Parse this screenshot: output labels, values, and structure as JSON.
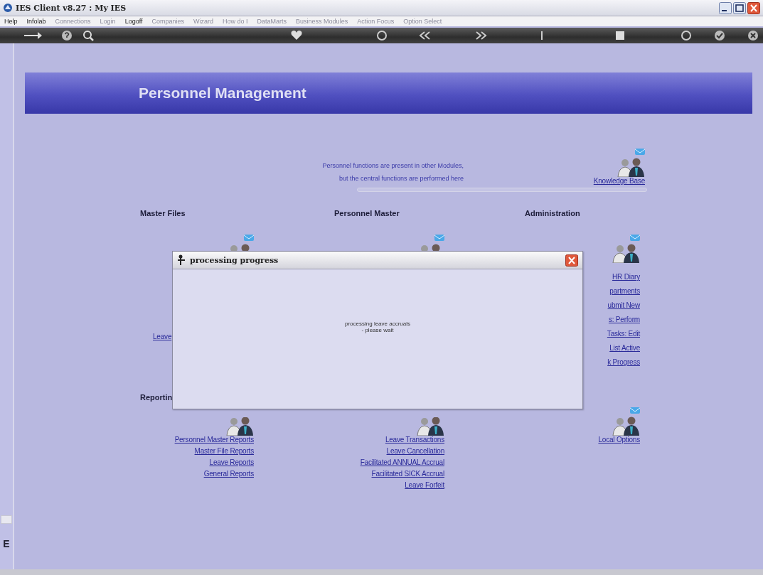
{
  "window": {
    "title": "IES Client v8.27 : My IES"
  },
  "menu": [
    {
      "label": "Help",
      "disabled": false
    },
    {
      "label": "Infolab",
      "disabled": false
    },
    {
      "label": "Connections",
      "disabled": true
    },
    {
      "label": "Login",
      "disabled": true
    },
    {
      "label": "Logoff",
      "disabled": false
    },
    {
      "label": "Companies",
      "disabled": true
    },
    {
      "label": "Wizard",
      "disabled": true
    },
    {
      "label": "How do I",
      "disabled": true
    },
    {
      "label": "DataMarts",
      "disabled": true
    },
    {
      "label": "Business Modules",
      "disabled": true
    },
    {
      "label": "Action Focus",
      "disabled": true
    },
    {
      "label": "Option Select",
      "disabled": true
    }
  ],
  "toolbar": [
    {
      "kind": "arrow"
    },
    {
      "kind": "help"
    },
    {
      "kind": "search"
    },
    {
      "kind": "heart"
    },
    {
      "kind": "circle"
    },
    {
      "kind": "rewind"
    },
    {
      "kind": "forward"
    },
    {
      "kind": "bar"
    },
    {
      "kind": "square"
    },
    {
      "kind": "circle"
    },
    {
      "kind": "check"
    },
    {
      "kind": "close"
    }
  ],
  "banner": {
    "title": "Personnel Management"
  },
  "info": {
    "lines": [
      "Personnel functions are present in other Modules,",
      "but the central functions are performed here"
    ],
    "link": "Knowledge Base"
  },
  "sections": [
    {
      "title": "Master Files",
      "links": [
        "Leave"
      ]
    },
    {
      "title": "Personnel Master"
    },
    {
      "title": "Administration",
      "links": [
        "HR Diary",
        "partments",
        "ubmit New",
        "s: Perform",
        "Tasks: Edit",
        "List Active",
        "k Progress"
      ]
    }
  ],
  "reporting": {
    "title": "Reportin",
    "columns": [
      [
        "Personnel Master Reports",
        "Master File Reports",
        "Leave Reports",
        "General Reports"
      ],
      [
        "Leave Transactions",
        "Leave Cancellation",
        "Facilitated ANNUAL Accrual",
        "Facilitated SICK Accrual",
        "Leave Forfeit"
      ],
      [
        "Local Options"
      ]
    ]
  },
  "side": {
    "label": "E"
  },
  "dialog": {
    "title": "processing progress",
    "lines": [
      "processing leave accruals",
      "- please wait"
    ]
  }
}
